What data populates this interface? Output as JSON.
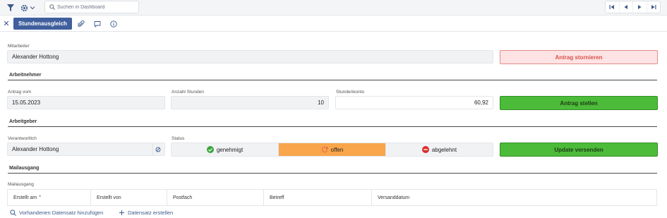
{
  "toolbar": {
    "filter_icon": "filter-icon",
    "settings_icon": "gear-icon",
    "search_placeholder": "Suchen in Dashboard",
    "nav_icons": [
      "first-icon",
      "previous-icon",
      "next-icon",
      "last-icon"
    ]
  },
  "tabs": {
    "active_label": "Stundenausgleich",
    "icons": [
      "paperclip-icon",
      "comment-icon",
      "info-icon"
    ]
  },
  "form": {
    "mitarbeiter_label": "Mitarbeiter",
    "mitarbeiter_value": "Alexander Hottong",
    "cancel_button": "Antrag stornieren",
    "section_arbeitnehmer": "Arbeitnehmer",
    "antrag_vom_label": "Antrag vom",
    "antrag_vom_value": "15.05.2023",
    "anzahl_stunden_label": "Anzahl Stunden",
    "anzahl_stunden_value": "10",
    "stundenkonto_label": "Stundenkonto",
    "stundenkonto_value": "60,92",
    "submit_button": "Antrag stellen",
    "section_arbeitgeber": "Arbeitgeber",
    "verantwortlich_label": "Verantwortlich",
    "verantwortlich_value": "Alexander Hottong",
    "status_label": "Status",
    "status_options": [
      {
        "label": "genehmigt",
        "icon": "check-circle-icon",
        "color": "#3aa63a"
      },
      {
        "label": "offen",
        "icon": "refresh-icon",
        "color": "#d9534f"
      },
      {
        "label": "abgelehnt",
        "icon": "minus-circle-icon",
        "color": "#d9302c"
      }
    ],
    "status_selected": "offen",
    "update_button": "Update versenden",
    "section_mailausgang": "Mailausgang"
  },
  "mail": {
    "label": "Mailausgang",
    "columns": [
      "Erstellt am",
      "Erstellt von",
      "Postfach",
      "Betreff",
      "Versanddatum"
    ],
    "sort_indicator": "^",
    "add_existing": "Vorhandenen Datensatz hinzufügen",
    "create": "Datensatz erstellen"
  },
  "colors": {
    "primary": "#3f5f9d",
    "success": "#4dbb3a",
    "danger_bg": "#fde3e3",
    "danger_text": "#d9534f",
    "warning": "#f9a54b"
  }
}
